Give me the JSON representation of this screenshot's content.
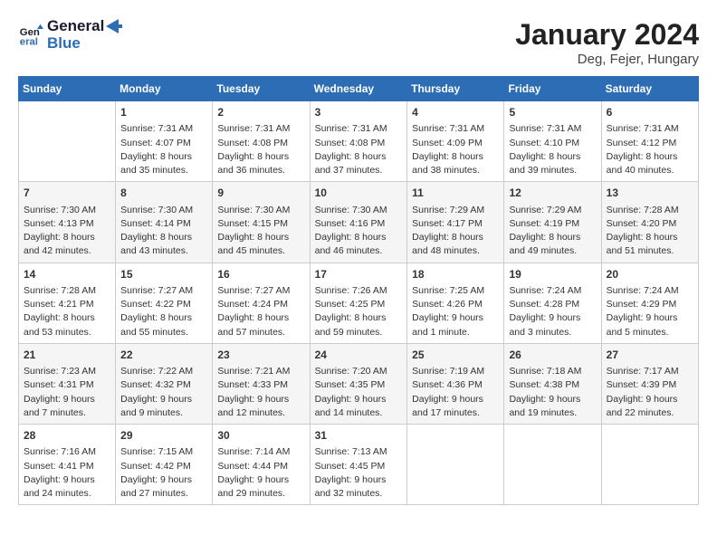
{
  "header": {
    "logo_line1": "General",
    "logo_line2": "Blue",
    "month_title": "January 2024",
    "location": "Deg, Fejer, Hungary"
  },
  "days_of_week": [
    "Sunday",
    "Monday",
    "Tuesday",
    "Wednesday",
    "Thursday",
    "Friday",
    "Saturday"
  ],
  "weeks": [
    [
      {
        "day": "",
        "content": ""
      },
      {
        "day": "1",
        "content": "Sunrise: 7:31 AM\nSunset: 4:07 PM\nDaylight: 8 hours\nand 35 minutes."
      },
      {
        "day": "2",
        "content": "Sunrise: 7:31 AM\nSunset: 4:08 PM\nDaylight: 8 hours\nand 36 minutes."
      },
      {
        "day": "3",
        "content": "Sunrise: 7:31 AM\nSunset: 4:08 PM\nDaylight: 8 hours\nand 37 minutes."
      },
      {
        "day": "4",
        "content": "Sunrise: 7:31 AM\nSunset: 4:09 PM\nDaylight: 8 hours\nand 38 minutes."
      },
      {
        "day": "5",
        "content": "Sunrise: 7:31 AM\nSunset: 4:10 PM\nDaylight: 8 hours\nand 39 minutes."
      },
      {
        "day": "6",
        "content": "Sunrise: 7:31 AM\nSunset: 4:12 PM\nDaylight: 8 hours\nand 40 minutes."
      }
    ],
    [
      {
        "day": "7",
        "content": "Sunrise: 7:30 AM\nSunset: 4:13 PM\nDaylight: 8 hours\nand 42 minutes."
      },
      {
        "day": "8",
        "content": "Sunrise: 7:30 AM\nSunset: 4:14 PM\nDaylight: 8 hours\nand 43 minutes."
      },
      {
        "day": "9",
        "content": "Sunrise: 7:30 AM\nSunset: 4:15 PM\nDaylight: 8 hours\nand 45 minutes."
      },
      {
        "day": "10",
        "content": "Sunrise: 7:30 AM\nSunset: 4:16 PM\nDaylight: 8 hours\nand 46 minutes."
      },
      {
        "day": "11",
        "content": "Sunrise: 7:29 AM\nSunset: 4:17 PM\nDaylight: 8 hours\nand 48 minutes."
      },
      {
        "day": "12",
        "content": "Sunrise: 7:29 AM\nSunset: 4:19 PM\nDaylight: 8 hours\nand 49 minutes."
      },
      {
        "day": "13",
        "content": "Sunrise: 7:28 AM\nSunset: 4:20 PM\nDaylight: 8 hours\nand 51 minutes."
      }
    ],
    [
      {
        "day": "14",
        "content": "Sunrise: 7:28 AM\nSunset: 4:21 PM\nDaylight: 8 hours\nand 53 minutes."
      },
      {
        "day": "15",
        "content": "Sunrise: 7:27 AM\nSunset: 4:22 PM\nDaylight: 8 hours\nand 55 minutes."
      },
      {
        "day": "16",
        "content": "Sunrise: 7:27 AM\nSunset: 4:24 PM\nDaylight: 8 hours\nand 57 minutes."
      },
      {
        "day": "17",
        "content": "Sunrise: 7:26 AM\nSunset: 4:25 PM\nDaylight: 8 hours\nand 59 minutes."
      },
      {
        "day": "18",
        "content": "Sunrise: 7:25 AM\nSunset: 4:26 PM\nDaylight: 9 hours\nand 1 minute."
      },
      {
        "day": "19",
        "content": "Sunrise: 7:24 AM\nSunset: 4:28 PM\nDaylight: 9 hours\nand 3 minutes."
      },
      {
        "day": "20",
        "content": "Sunrise: 7:24 AM\nSunset: 4:29 PM\nDaylight: 9 hours\nand 5 minutes."
      }
    ],
    [
      {
        "day": "21",
        "content": "Sunrise: 7:23 AM\nSunset: 4:31 PM\nDaylight: 9 hours\nand 7 minutes."
      },
      {
        "day": "22",
        "content": "Sunrise: 7:22 AM\nSunset: 4:32 PM\nDaylight: 9 hours\nand 9 minutes."
      },
      {
        "day": "23",
        "content": "Sunrise: 7:21 AM\nSunset: 4:33 PM\nDaylight: 9 hours\nand 12 minutes."
      },
      {
        "day": "24",
        "content": "Sunrise: 7:20 AM\nSunset: 4:35 PM\nDaylight: 9 hours\nand 14 minutes."
      },
      {
        "day": "25",
        "content": "Sunrise: 7:19 AM\nSunset: 4:36 PM\nDaylight: 9 hours\nand 17 minutes."
      },
      {
        "day": "26",
        "content": "Sunrise: 7:18 AM\nSunset: 4:38 PM\nDaylight: 9 hours\nand 19 minutes."
      },
      {
        "day": "27",
        "content": "Sunrise: 7:17 AM\nSunset: 4:39 PM\nDaylight: 9 hours\nand 22 minutes."
      }
    ],
    [
      {
        "day": "28",
        "content": "Sunrise: 7:16 AM\nSunset: 4:41 PM\nDaylight: 9 hours\nand 24 minutes."
      },
      {
        "day": "29",
        "content": "Sunrise: 7:15 AM\nSunset: 4:42 PM\nDaylight: 9 hours\nand 27 minutes."
      },
      {
        "day": "30",
        "content": "Sunrise: 7:14 AM\nSunset: 4:44 PM\nDaylight: 9 hours\nand 29 minutes."
      },
      {
        "day": "31",
        "content": "Sunrise: 7:13 AM\nSunset: 4:45 PM\nDaylight: 9 hours\nand 32 minutes."
      },
      {
        "day": "",
        "content": ""
      },
      {
        "day": "",
        "content": ""
      },
      {
        "day": "",
        "content": ""
      }
    ]
  ]
}
